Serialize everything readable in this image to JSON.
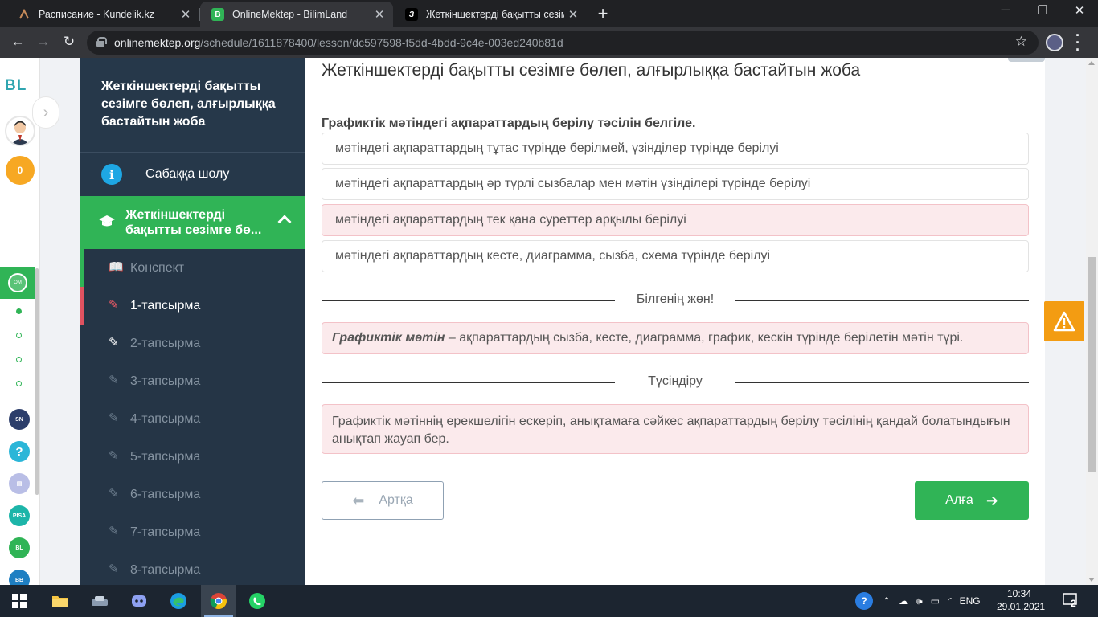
{
  "browser": {
    "tabs": [
      {
        "title": "Расписание - Kundelik.kz",
        "favicon": "kundelik-icon"
      },
      {
        "title": "OnlineMektep - BilimLand",
        "favicon": "bilimland-icon"
      },
      {
        "title": "Жеткіншектерді бақытты сезімге бөл",
        "favicon": "z-icon"
      }
    ],
    "url_host": "onlinemektep.org",
    "url_path": "/schedule/1611878400/lesson/dc597598-f5dd-4bdd-9c4e-003ed240b81d"
  },
  "rail": {
    "logo": "BL",
    "coins": "0"
  },
  "sidebar": {
    "lesson_title": "Жеткіншектерді бақытты сезімге бөлеп, алғырлыққа бастайтын жоба",
    "overview_label": "Сабаққа шолу",
    "active_lesson_label": "Жеткіншектерді бақытты сезімге бө...",
    "tasks": [
      {
        "label": "Конспект",
        "icon": "book-icon"
      },
      {
        "label": "1-тапсырма",
        "icon": "edit-icon"
      },
      {
        "label": "2-тапсырма",
        "icon": "edit-icon"
      },
      {
        "label": "3-тапсырма",
        "icon": "edit-icon"
      },
      {
        "label": "4-тапсырма",
        "icon": "edit-icon"
      },
      {
        "label": "5-тапсырма",
        "icon": "edit-icon"
      },
      {
        "label": "6-тапсырма",
        "icon": "edit-icon"
      },
      {
        "label": "7-тапсырма",
        "icon": "edit-icon"
      },
      {
        "label": "8-тапсырма",
        "icon": "edit-icon"
      }
    ]
  },
  "main": {
    "title": "Жеткіншектерді бақытты сезімге бөлеп, алғырлыққа бастайтын жоба",
    "question": "Графиктік мәтіндегі ақпараттардың берілу тәсілін белгіле.",
    "options": [
      "мәтіндегі ақпараттардың тұтас түрінде берілмей, үзінділер түрінде берілуі",
      "мәтіндегі ақпараттардың әр түрлі сызбалар мен мәтін үзінділері түрінде берілуі",
      "мәтіндегі ақпараттардың тек қана суреттер арқылы берілуі",
      "мәтіндегі ақпараттардың кесте, диаграмма, сызба, схема түрінде берілуі"
    ],
    "know_heading": "Білгенің жөн!",
    "know_term": "Графиктік мәтін",
    "know_text": " – ақпараттардың сызба, кесте, диаграмма, график, кескін түрінде берілетін мәтін түрі.",
    "explain_heading": "Түсіндіру",
    "explain_text": "Графиктік мәтіннің ерекшелігін ескеріп, анықтамаға сәйкес ақпараттардың берілу тәсілінің қандай болатындығын анықтап жауап бер.",
    "back_label": "Артқа",
    "next_label": "Алға"
  },
  "taskbar": {
    "lang": "ENG",
    "time": "10:34",
    "date": "29.01.2021",
    "notifications": "2"
  },
  "colors": {
    "accent_green": "#30b456",
    "sidebar_bg": "#26384a",
    "wrong_bg": "#fbeaec",
    "warning": "#f39c12"
  }
}
